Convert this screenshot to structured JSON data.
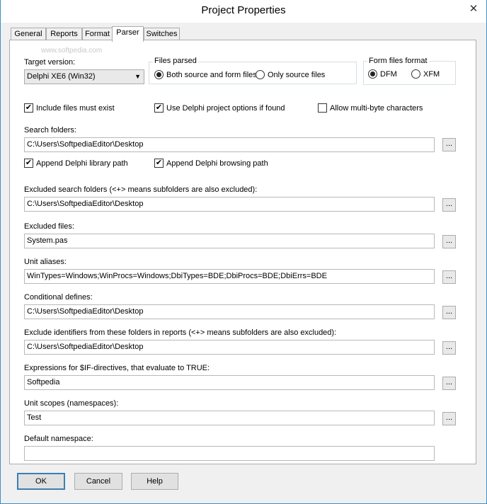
{
  "window": {
    "title": "Project Properties",
    "close_glyph": "✕"
  },
  "tabs": [
    {
      "label": "General"
    },
    {
      "label": "Reports"
    },
    {
      "label": "Format"
    },
    {
      "label": "Parser"
    },
    {
      "label": "Switches"
    }
  ],
  "watermark": "www.softpedia.com",
  "target_version": {
    "label": "Target version:",
    "value": "Delphi XE6 (Win32)"
  },
  "files_parsed": {
    "title": "Files parsed",
    "both_label": "Both source and form files",
    "only_label": "Only source files",
    "selected": "both"
  },
  "form_files": {
    "title": "Form files format",
    "dfm_label": "DFM",
    "xfm_label": "XFM",
    "selected": "dfm"
  },
  "checks": {
    "include_files": {
      "label": "Include files must exist",
      "checked": true
    },
    "delphi_options": {
      "label": "Use Delphi project options if found",
      "checked": true
    },
    "multibyte": {
      "label": "Allow multi-byte characters",
      "checked": false
    },
    "append_library": {
      "label": "Append Delphi library path",
      "checked": true
    },
    "append_browsing": {
      "label": "Append Delphi browsing path",
      "checked": true
    }
  },
  "check_glyph": "✔",
  "browse_label": "...",
  "fields": {
    "search_folders": {
      "label": "Search folders:",
      "value": "C:\\Users\\SoftpediaEditor\\Desktop"
    },
    "excluded_folders": {
      "label": "Excluded search folders (<+> means subfolders are also excluded):",
      "value": "C:\\Users\\SoftpediaEditor\\Desktop"
    },
    "excluded_files": {
      "label": "Excluded files:",
      "value": "System.pas"
    },
    "unit_aliases": {
      "label": "Unit aliases:",
      "value": "WinTypes=Windows;WinProcs=Windows;DbiTypes=BDE;DbiProcs=BDE;DbiErrs=BDE"
    },
    "conditional_defines": {
      "label": "Conditional defines:",
      "value": "C:\\Users\\SoftpediaEditor\\Desktop"
    },
    "exclude_identifiers": {
      "label": "Exclude identifiers from these folders in reports (<+> means subfolders are also excluded):",
      "value": "C:\\Users\\SoftpediaEditor\\Desktop"
    },
    "if_expressions": {
      "label": "Expressions for $IF-directives, that evaluate to TRUE:",
      "value": "Softpedia"
    },
    "unit_scopes": {
      "label": "Unit scopes (namespaces):",
      "value": "Test"
    },
    "default_namespace": {
      "label": "Default namespace:",
      "value": ""
    }
  },
  "buttons": {
    "ok": "OK",
    "cancel": "Cancel",
    "help": "Help"
  }
}
